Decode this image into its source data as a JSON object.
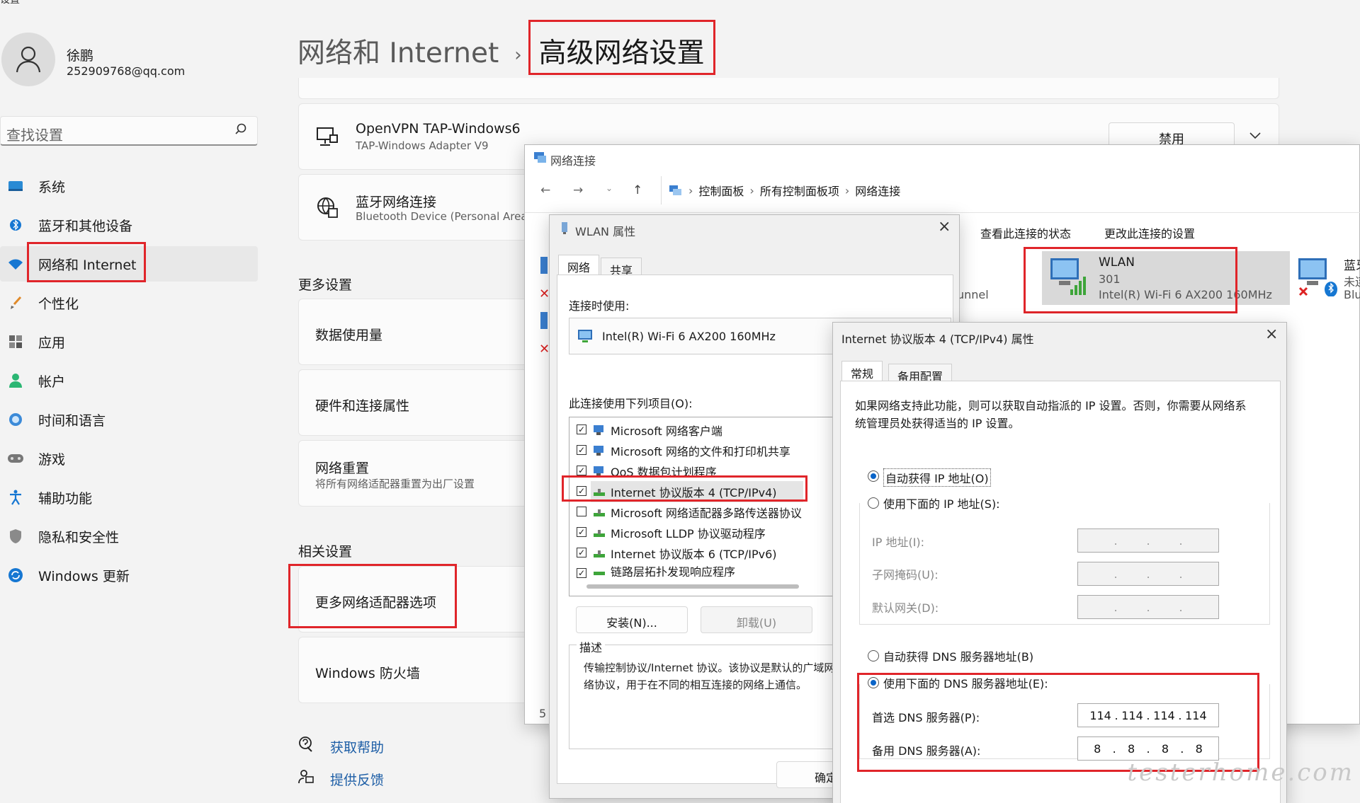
{
  "window": {
    "app_title": "设置"
  },
  "user": {
    "name": "徐鹏",
    "email": "252909768@qq.com"
  },
  "search": {
    "placeholder": "查找设置"
  },
  "sidebar": {
    "items": [
      {
        "label": "系统"
      },
      {
        "label": "蓝牙和其他设备"
      },
      {
        "label": "网络和 Internet"
      },
      {
        "label": "个性化"
      },
      {
        "label": "应用"
      },
      {
        "label": "帐户"
      },
      {
        "label": "时间和语言"
      },
      {
        "label": "游戏"
      },
      {
        "label": "辅助功能"
      },
      {
        "label": "隐私和安全性"
      },
      {
        "label": "Windows 更新"
      }
    ]
  },
  "breadcrumb": {
    "parent": "网络和 Internet",
    "sep": "›",
    "current": "高级网络设置"
  },
  "adapters": [
    {
      "title": "OpenVPN TAP-Windows6",
      "subtitle": "TAP-Windows Adapter V9",
      "button": "禁用"
    },
    {
      "title": "蓝牙网络连接",
      "subtitle": "Bluetooth Device (Personal Area"
    }
  ],
  "more_settings": {
    "heading": "更多设置",
    "items": [
      {
        "title": "数据使用量"
      },
      {
        "title": "硬件和连接属性"
      },
      {
        "title": "网络重置",
        "subtitle": "将所有网络适配器重置为出厂设置"
      }
    ]
  },
  "related": {
    "heading": "相关设置",
    "items": [
      {
        "title": "更多网络适配器选项"
      },
      {
        "title": "Windows 防火墙"
      }
    ]
  },
  "help": {
    "get_help": "获取帮助",
    "feedback": "提供反馈"
  },
  "netconn": {
    "title": "网络连接",
    "path": [
      "控制面板",
      "所有控制面板项",
      "网络连接"
    ],
    "cmd_status": "查看此连接的状态",
    "cmd_change": "更改此连接的设置",
    "partial_left": "unnel",
    "partial_bottom": "5",
    "wlan": {
      "name": "WLAN",
      "ssid": "301",
      "device": "Intel(R) Wi-Fi 6 AX200 160MHz"
    },
    "bt": {
      "name": "蓝牙",
      "status": "未连",
      "device": "Blu"
    }
  },
  "wlan_props": {
    "title": "WLAN 属性",
    "tabs": [
      "网络",
      "共享"
    ],
    "connect_using_label": "连接时使用:",
    "adapter": "Intel(R) Wi-Fi 6 AX200 160MHz",
    "items_label": "此连接使用下列项目(O):",
    "items": [
      {
        "label": "Microsoft 网络客户端",
        "checked": true
      },
      {
        "label": "Microsoft 网络的文件和打印机共享",
        "checked": true
      },
      {
        "label": "QoS 数据包计划程序",
        "checked": true
      },
      {
        "label": "Internet 协议版本 4 (TCP/IPv4)",
        "checked": true
      },
      {
        "label": "Microsoft 网络适配器多路传送器协议",
        "checked": false
      },
      {
        "label": "Microsoft LLDP 协议驱动程序",
        "checked": true
      },
      {
        "label": "Internet 协议版本 6 (TCP/IPv6)",
        "checked": true
      },
      {
        "label": "链路层拓扑发现响应程序",
        "checked": true
      }
    ],
    "install": "安装(N)...",
    "uninstall": "卸载(U)",
    "desc_label": "描述",
    "desc_text": "传输控制协议/Internet 协议。该协议是默认的广域网络协议，用于在不同的相互连接的网络上通信。",
    "ok": "确定"
  },
  "ipv4": {
    "title": "Internet 协议版本 4 (TCP/IPv4) 属性",
    "tabs": [
      "常规",
      "备用配置"
    ],
    "intro": "如果网络支持此功能，则可以获取自动指派的 IP 设置。否则，你需要从网络系统管理员处获得适当的 IP 设置。",
    "auto_ip": "自动获得 IP 地址(O)",
    "manual_ip": "使用下面的 IP 地址(S):",
    "ip_label": "IP 地址(I):",
    "mask_label": "子网掩码(U):",
    "gw_label": "默认网关(D):",
    "auto_dns": "自动获得 DNS 服务器地址(B)",
    "manual_dns": "使用下面的 DNS 服务器地址(E):",
    "pref_dns_label": "首选 DNS 服务器(P):",
    "alt_dns_label": "备用 DNS 服务器(A):",
    "pref_dns": [
      "114",
      "114",
      "114",
      "114"
    ],
    "alt_dns": [
      "8",
      "8",
      "8",
      "8"
    ]
  },
  "watermark": "testerhome.com"
}
